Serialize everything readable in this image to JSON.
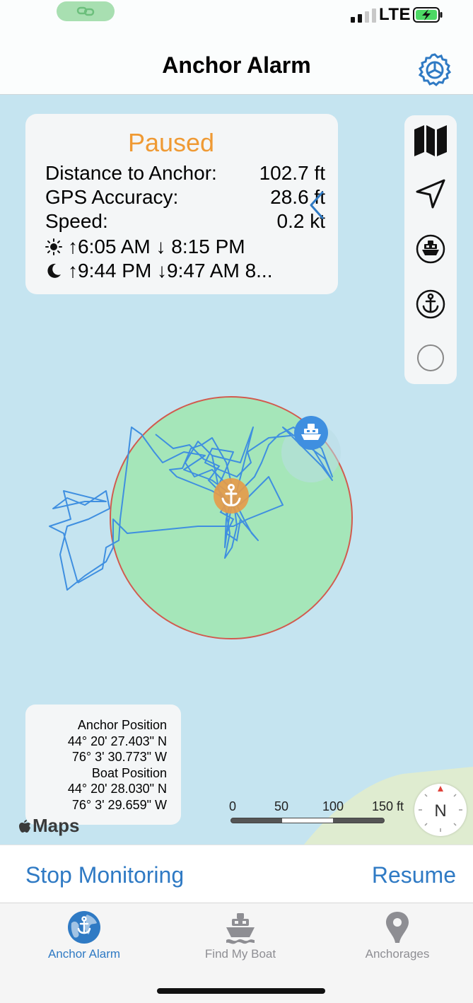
{
  "status_bar": {
    "network": "LTE",
    "icons": {
      "link": "link-icon",
      "signal": "signal-bars-icon",
      "battery": "battery-charging-icon"
    }
  },
  "nav": {
    "title": "Anchor Alarm",
    "settings_icon": "gear-steering-wheel-icon"
  },
  "info_card": {
    "status": "Paused",
    "rows": [
      {
        "label": "Distance to Anchor:",
        "value": "102.7 ft"
      },
      {
        "label": "GPS Accuracy:",
        "value": "28.6 ft"
      },
      {
        "label": "Speed:",
        "value": "0.2 kt"
      }
    ],
    "sun_line": "↑6:05 AM ↓ 8:15 PM",
    "moon_line": "↑9:44 PM ↓9:47 AM  8...",
    "icons": {
      "sun": "sun-icon",
      "moon": "moon-icon",
      "collapse": "chevron-left-icon"
    }
  },
  "map_controls": [
    "map-icon",
    "location-arrow-icon",
    "boat-icon",
    "anchor-icon",
    "circle-icon"
  ],
  "coordinates": {
    "anchor_label": "Anchor Position",
    "anchor_lat": "44° 20' 27.403\" N",
    "anchor_lon": "76° 3' 30.773\" W",
    "boat_label": "Boat Position",
    "boat_lat": "44° 20' 28.030\" N",
    "boat_lon": "76° 3' 29.659\" W"
  },
  "map_attribution": "Maps",
  "scale": {
    "labels": [
      "0",
      "50",
      "100",
      "150 ft"
    ]
  },
  "compass": {
    "label": "N"
  },
  "colors": {
    "accent": "#2f7ac4",
    "paused": "#ef9a34",
    "water": "#c5e4f0",
    "alarm_zone": "#a5e6b9",
    "zone_border": "#d25a4e",
    "track": "#3f8fe0",
    "anchor_marker": "#e79a48"
  },
  "actions": {
    "stop": "Stop Monitoring",
    "resume": "Resume"
  },
  "tabs": [
    {
      "label": "Anchor Alarm",
      "icon": "globe-anchor-icon",
      "active": true
    },
    {
      "label": "Find My Boat",
      "icon": "boat-icon",
      "active": false
    },
    {
      "label": "Anchorages",
      "icon": "map-pin-icon",
      "active": false
    }
  ]
}
